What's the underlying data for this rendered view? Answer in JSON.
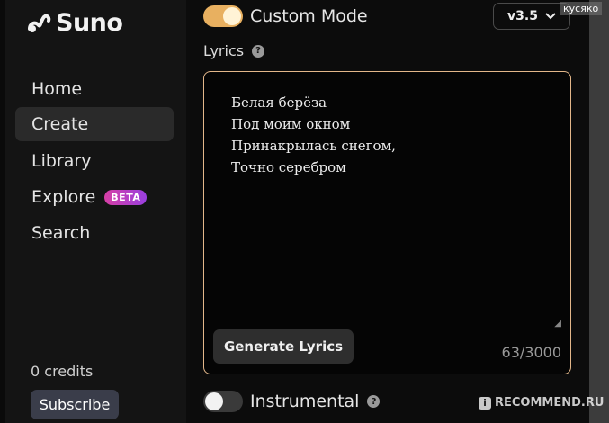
{
  "sidebar": {
    "logo_text": "Suno",
    "items": [
      {
        "label": "Home"
      },
      {
        "label": "Create",
        "active": true
      },
      {
        "label": "Library"
      },
      {
        "label": "Explore",
        "badge": "BETA"
      },
      {
        "label": "Search"
      }
    ],
    "credits": "0 credits",
    "subscribe_label": "Subscribe"
  },
  "create": {
    "custom_mode_label": "Custom Mode",
    "custom_mode_on": true,
    "version": "v3.5",
    "lyrics_label": "Lyrics",
    "lyrics_text": "Белая берёза\nПод моим окном\nПринакрылась снегом,\nТочно серебром",
    "generate_lyrics_label": "Generate Lyrics",
    "char_count": "63/3000",
    "instrumental_label": "Instrumental",
    "instrumental_on": false
  },
  "watermarks": {
    "top": "кусяко",
    "bottom": "RECOMMEND.RU"
  },
  "colors": {
    "accent": "#e8b060",
    "lyrics_border": "#e3b78a",
    "beta_gradient_start": "#d63fa5",
    "beta_gradient_end": "#9a3fe0"
  }
}
